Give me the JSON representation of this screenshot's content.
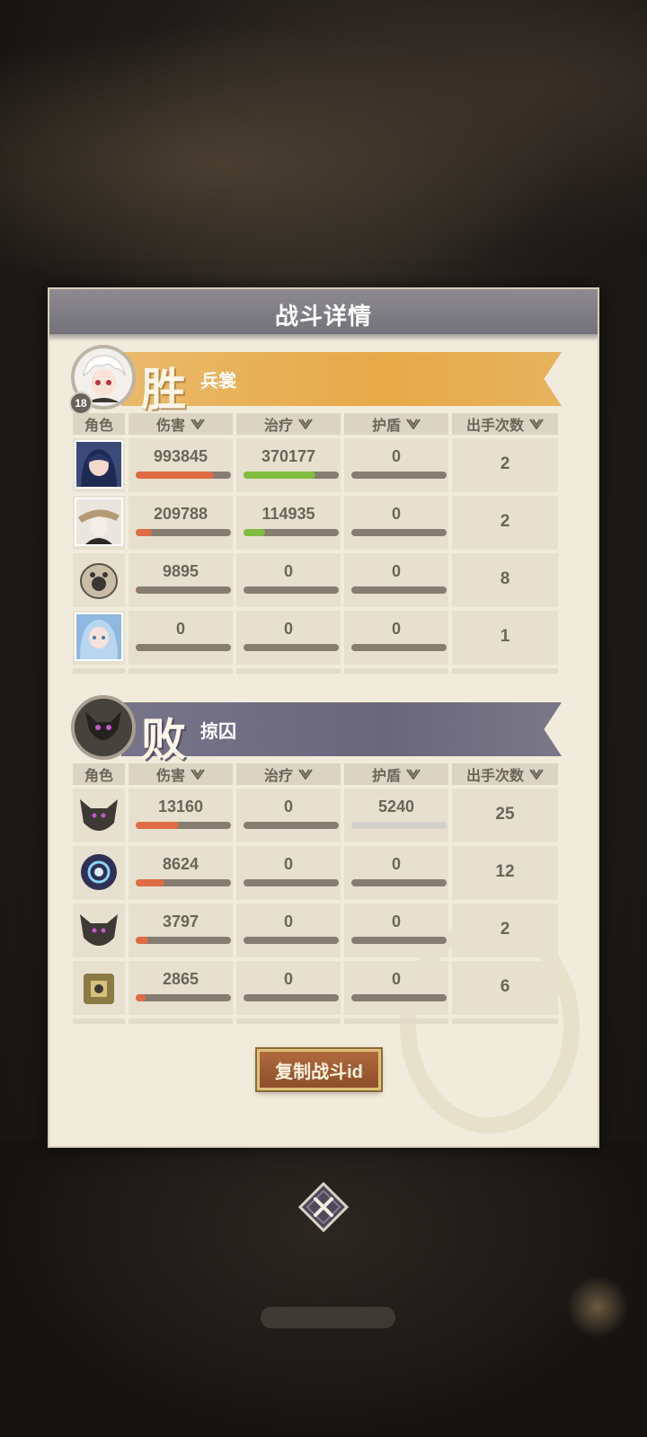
{
  "dialog": {
    "title": "战斗详情"
  },
  "columns": [
    "角色",
    "伤害",
    "治疗",
    "护盾",
    "出手次数"
  ],
  "winner": {
    "result": "胜",
    "name": "兵裳",
    "level": "18",
    "rows": [
      {
        "damage": "993845",
        "damage_pct": 0.82,
        "heal": "370177",
        "heal_pct": 0.75,
        "shield": "0",
        "shield_pct": 0,
        "turns": "2"
      },
      {
        "damage": "209788",
        "damage_pct": 0.17,
        "heal": "114935",
        "heal_pct": 0.23,
        "shield": "0",
        "shield_pct": 0,
        "turns": "2"
      },
      {
        "damage": "9895",
        "damage_pct": 0.01,
        "heal": "0",
        "heal_pct": 0,
        "shield": "0",
        "shield_pct": 0,
        "turns": "8"
      },
      {
        "damage": "0",
        "damage_pct": 0,
        "heal": "0",
        "heal_pct": 0,
        "shield": "0",
        "shield_pct": 0,
        "turns": "1"
      }
    ]
  },
  "loser": {
    "result": "败",
    "name": "掠囚",
    "rows": [
      {
        "damage": "13160",
        "damage_pct": 0.45,
        "heal": "0",
        "heal_pct": 0,
        "shield": "5240",
        "shield_pct": 0,
        "shield_light": true,
        "turns": "25"
      },
      {
        "damage": "8624",
        "damage_pct": 0.3,
        "heal": "0",
        "heal_pct": 0,
        "shield": "0",
        "shield_pct": 0,
        "turns": "12"
      },
      {
        "damage": "3797",
        "damage_pct": 0.13,
        "heal": "0",
        "heal_pct": 0,
        "shield": "0",
        "shield_pct": 0,
        "turns": "2"
      },
      {
        "damage": "2865",
        "damage_pct": 0.1,
        "heal": "0",
        "heal_pct": 0,
        "shield": "0",
        "shield_pct": 0,
        "turns": "6"
      }
    ]
  },
  "copy_button": "复制战斗id",
  "icons": {
    "sort": "sort-down-icon",
    "close": "close-icon"
  },
  "colors": {
    "damage_bar": "#e06c43",
    "heal_bar": "#7fbd3e",
    "bar_track": "#867c70",
    "win_banner": "#e8a947",
    "lose_banner": "#6a677c",
    "button": "#8e4f2a"
  }
}
